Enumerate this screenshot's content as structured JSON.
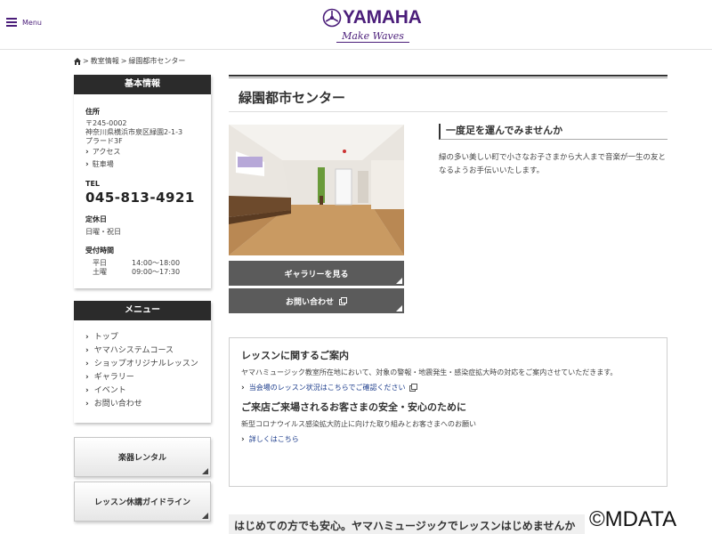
{
  "header": {
    "menu_label": "Menu",
    "logo_text": "YAMAHA",
    "logo_tagline": "Make Waves"
  },
  "breadcrumb": [
    "教室情報",
    "緑園都市センター"
  ],
  "sidebar": {
    "basic_info": {
      "heading": "基本情報",
      "address_label": "住所",
      "address": [
        "〒245-0002",
        "神奈川県横浜市泉区緑園2-1-3",
        "プラード3F"
      ],
      "links": [
        "アクセス",
        "駐車場"
      ],
      "tel_label": "TEL",
      "tel": "045-813-4921",
      "holiday_label": "定休日",
      "holiday": "日曜・祝日",
      "hours_label": "受付時間",
      "hours": [
        {
          "day": "平日",
          "time": "14:00〜18:00"
        },
        {
          "day": "土曜",
          "time": "09:00〜17:30"
        }
      ]
    },
    "menu": {
      "heading": "メニュー",
      "items": [
        "トップ",
        "ヤマハシステムコース",
        "ショップオリジナルレッスン",
        "ギャラリー",
        "イベント",
        "お問い合わせ"
      ]
    },
    "rental_button": "楽器レンタル",
    "guideline_button": "レッスン休講ガイドライン"
  },
  "main": {
    "title": "緑園都市センター",
    "gallery_button": "ギャラリーを見る",
    "contact_button": "お問い合わせ",
    "sub_heading": "一度足を運んでみませんか",
    "sub_text": "緑の多い美しい町で小さなお子さまから大人まで音楽が一生の友となるようお手伝いいたします。",
    "notice": {
      "title1": "レッスンに関するご案内",
      "text1": "ヤマハミュージック教室所在地において、対象の警報・地震発生・感染症拡大時の対応をご案内させていただきます。",
      "link1": "当会場のレッスン状況はこちらでご確認ください",
      "title2": "ご来店ご来場されるお客さまの安全・安心のために",
      "text2": "新型コロナウイルス感染拡大防止に向けた取り組みとお客さまへのお願い",
      "link2": "詳しくはこちら"
    },
    "bottom_heading": "はじめての方でも安心。ヤマハミュージックでレッスンはじめませんか"
  },
  "watermark": "©MDATA",
  "colors": {
    "brand": "#4b1e7a",
    "dark_button": "#5b5b5b",
    "link": "#1d3d8c"
  }
}
